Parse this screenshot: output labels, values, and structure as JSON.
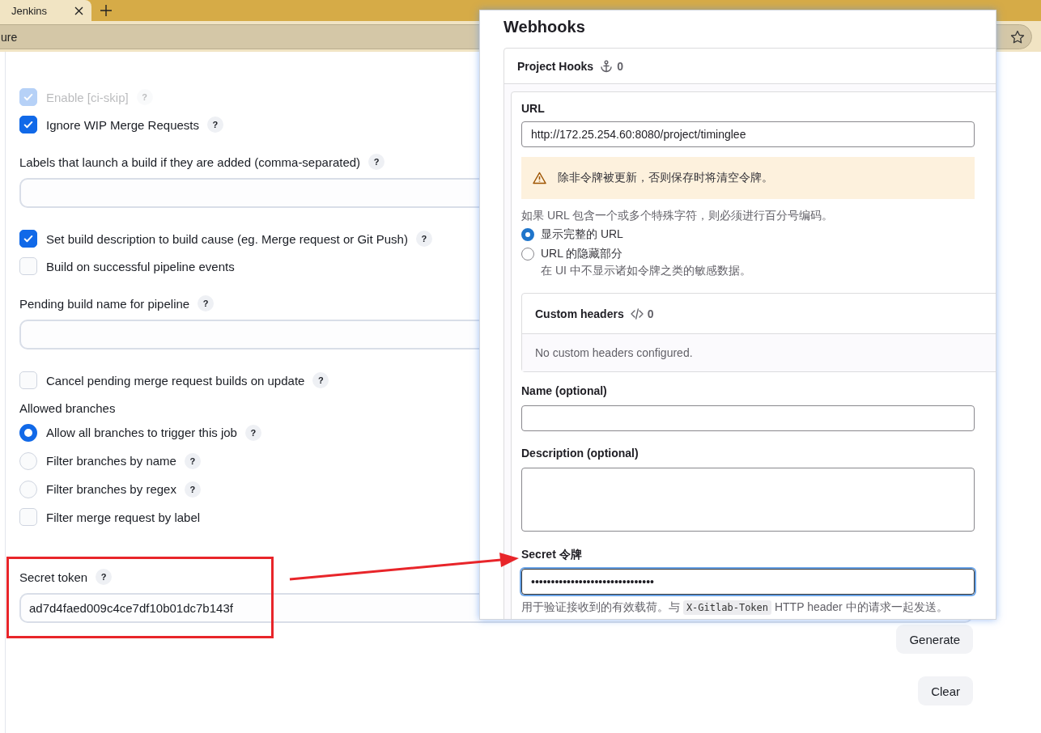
{
  "browser": {
    "tab": {
      "title": "Jenkins"
    },
    "address": "ure"
  },
  "jenkins": {
    "items": [
      {
        "kind": "checkbox",
        "label": "Enable [ci-skip]",
        "checked": true,
        "disabled": true,
        "help": "?"
      },
      {
        "kind": "checkbox",
        "label": "Ignore WIP Merge Requests",
        "checked": true,
        "disabled": false,
        "help": "?"
      },
      {
        "kind": "field",
        "label": "Labels that launch a build if they are added (comma-separated)",
        "help": "?"
      },
      {
        "kind": "checkbox",
        "label": "Set build description to build cause (eg. Merge request or Git Push)",
        "checked": true,
        "disabled": false,
        "help": "?"
      },
      {
        "kind": "checkbox",
        "label": "Build on successful pipeline events",
        "checked": false,
        "disabled": false
      },
      {
        "kind": "field",
        "label": "Pending build name for pipeline",
        "help": "?"
      },
      {
        "kind": "checkbox",
        "label": "Cancel pending merge request builds on update",
        "checked": false,
        "disabled": false,
        "help": "?"
      },
      {
        "kind": "heading",
        "label": "Allowed branches"
      },
      {
        "kind": "radio",
        "label": "Allow all branches to trigger this job",
        "selected": true,
        "help": "?"
      },
      {
        "kind": "radio",
        "label": "Filter branches by name",
        "selected": false,
        "help": "?"
      },
      {
        "kind": "radio",
        "label": "Filter branches by regex",
        "selected": false,
        "help": "?"
      },
      {
        "kind": "checkbox",
        "label": "Filter merge request by label",
        "checked": false,
        "disabled": false
      },
      {
        "kind": "token-field",
        "label": "Secret token",
        "help": "?",
        "value": "ad7d4faed009c4ce7df10b01dc7b143f"
      },
      {
        "kind": "button",
        "label": "Generate"
      },
      {
        "kind": "button",
        "label": "Clear"
      }
    ]
  },
  "webhooks": {
    "title": "Webhooks",
    "project_hooks": {
      "title": "Project Hooks",
      "count": "0"
    },
    "form": {
      "url_label": "URL",
      "url_value": "http://172.25.254.60:8080/project/timinglee",
      "warning": "除非令牌被更新，否则保存时将清空令牌。",
      "hint": "如果 URL 包含一个或多个特殊字符，则必须进行百分号编码。",
      "url_display": [
        {
          "label": "显示完整的 URL",
          "selected": true
        },
        {
          "label": "URL 的隐藏部分",
          "selected": false,
          "description": "在 UI 中不显示诸如令牌之类的敏感数据。"
        }
      ],
      "custom_headers": {
        "title": "Custom headers",
        "count": "0",
        "empty": "No custom headers configured."
      },
      "name_label": "Name (optional)",
      "description_label": "Description (optional)",
      "secret_label": "Secret 令牌",
      "secret_value": "•••••••••••••••••••••••••••••••",
      "secret_focused": true,
      "secret_help": {
        "before": "用于验证接收到的有效载荷。与",
        "code": "X-Gitlab-Token",
        "after": "HTTP header 中的请求一起发送。"
      }
    }
  }
}
